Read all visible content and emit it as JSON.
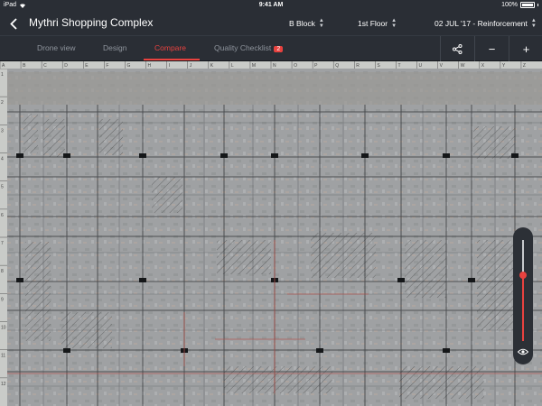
{
  "status_bar": {
    "carrier": "iPad",
    "time": "9:41 AM",
    "battery": "100%"
  },
  "header": {
    "title": "Mythri Shopping Complex",
    "block": "B Block",
    "floor": "1st Floor",
    "date_layer": "02 JUL '17 - Reinforcement"
  },
  "tabs": {
    "drone": "Drone view",
    "design": "Design",
    "compare": "Compare",
    "quality": "Quality Checklist",
    "quality_count": "2",
    "active": "compare"
  },
  "toolbar": {
    "minus": "−",
    "plus": "+"
  },
  "rulers": {
    "top": [
      "A",
      "B",
      "C",
      "D",
      "E",
      "F",
      "G",
      "H",
      "I",
      "J",
      "K",
      "L",
      "M",
      "N",
      "O",
      "P",
      "Q",
      "R",
      "S",
      "T",
      "U",
      "V",
      "W",
      "X",
      "Y",
      "Z"
    ],
    "left": [
      "1",
      "2",
      "3",
      "4",
      "5",
      "6",
      "7",
      "8",
      "9",
      "10",
      "11",
      "12"
    ]
  },
  "zoom": {
    "level": 0.65
  },
  "colors": {
    "accent": "#e8423f",
    "header_bg": "#2a2e35",
    "inactive_tab": "#8e949c"
  }
}
